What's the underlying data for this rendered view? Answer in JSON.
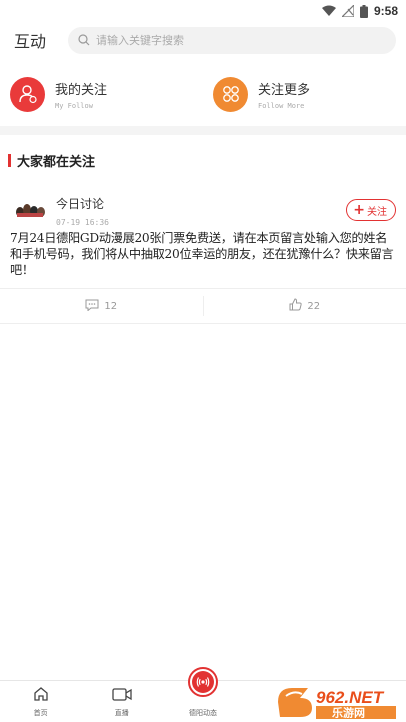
{
  "status_bar": {
    "time": "9:58"
  },
  "header": {
    "title": "互动",
    "search_placeholder": "请输入关键字搜索"
  },
  "follow": [
    {
      "title": "我的关注",
      "subtitle": "My Follow"
    },
    {
      "title": "关注更多",
      "subtitle": "Follow More"
    }
  ],
  "section": {
    "title": "大家都在关注"
  },
  "post": {
    "author": "今日讨论",
    "time": "07-19 16:36",
    "follow_label": "关注",
    "body": "7月24日德阳GD动漫展20张门票免费送，请在本页留言处输入您的姓名和手机号码，我们将从中抽取20位幸运的朋友，还在犹豫什么？快来留言吧！",
    "comments": "12",
    "likes": "22"
  },
  "tabbar": {
    "tabs": [
      {
        "label": "首页"
      },
      {
        "label": "直播"
      },
      {
        "label": "德阳动态"
      },
      {
        "label": ""
      },
      {
        "label": ""
      }
    ]
  },
  "watermark": {
    "text": "962.NET",
    "subtext": "乐游网"
  },
  "colors": {
    "accent": "#e23232",
    "orange": "#f08a32"
  }
}
